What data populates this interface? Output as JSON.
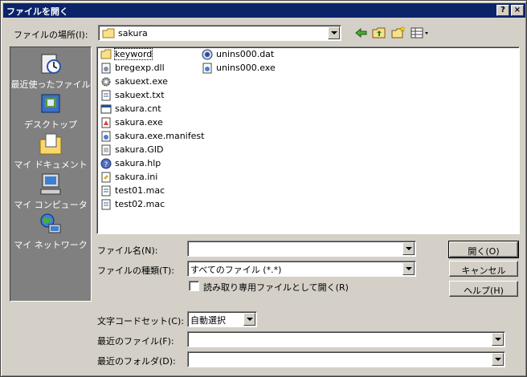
{
  "window": {
    "title": "ファイルを開く",
    "help_btn": "?",
    "close_btn": "×"
  },
  "lookin": {
    "label": "ファイルの場所(I):",
    "value": "sakura"
  },
  "places": [
    {
      "label": "最近使ったファイル",
      "icon": "recent-icon"
    },
    {
      "label": "デスクトップ",
      "icon": "desktop-icon"
    },
    {
      "label": "マイ ドキュメント",
      "icon": "my-documents-icon"
    },
    {
      "label": "マイ コンピュータ",
      "icon": "my-computer-icon"
    },
    {
      "label": "マイ ネットワーク",
      "icon": "my-network-icon"
    }
  ],
  "files": [
    {
      "name": "keyword",
      "icon": "folder-icon"
    },
    {
      "name": "bregexp.dll",
      "icon": "dll-icon"
    },
    {
      "name": "sakuext.exe",
      "icon": "gear-exe-icon"
    },
    {
      "name": "sakuext.txt",
      "icon": "text-file-icon"
    },
    {
      "name": "sakura.cnt",
      "icon": "cnt-file-icon"
    },
    {
      "name": "sakura.exe",
      "icon": "exe-icon"
    },
    {
      "name": "sakura.exe.manifest",
      "icon": "manifest-icon"
    },
    {
      "name": "sakura.GID",
      "icon": "gid-file-icon"
    },
    {
      "name": "sakura.hlp",
      "icon": "help-file-icon"
    },
    {
      "name": "sakura.ini",
      "icon": "ini-file-icon"
    },
    {
      "name": "test01.mac",
      "icon": "text-file-icon"
    },
    {
      "name": "test02.mac",
      "icon": "text-file-icon"
    },
    {
      "name": "unins000.dat",
      "icon": "dat-file-icon"
    },
    {
      "name": "unins000.exe",
      "icon": "exe-icon"
    }
  ],
  "fields": {
    "filename_label": "ファイル名(N):",
    "filename_value": "",
    "filetype_label": "ファイルの種類(T):",
    "filetype_value": "すべてのファイル (*.*)",
    "readonly_label": "読み取り専用ファイルとして開く(R)",
    "charset_label": "文字コードセット(C):",
    "charset_value": "自動選択",
    "recent_file_label": "最近のファイル(F):",
    "recent_file_value": "",
    "recent_folder_label": "最近のフォルダ(D):",
    "recent_folder_value": ""
  },
  "buttons": {
    "open": "開く(O)",
    "cancel": "キャンセル",
    "help": "ヘルプ(H)"
  },
  "colors": {
    "titlebar": "#0a246a",
    "face": "#d4d0c8",
    "places_bg": "#808080"
  }
}
